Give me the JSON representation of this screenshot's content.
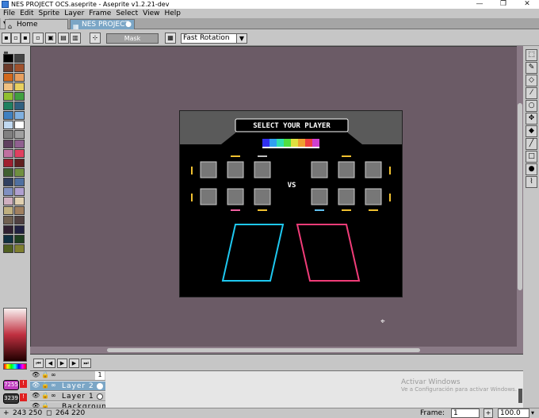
{
  "window": {
    "title": "NES PROJECT OCS.aseprite - Aseprite v1.2.21-dev",
    "minimize": "—",
    "maximize": "❐",
    "close": "✕"
  },
  "menu": [
    "File",
    "Edit",
    "Sprite",
    "Layer",
    "Frame",
    "Select",
    "View",
    "Help"
  ],
  "tabs": [
    {
      "label": "Home",
      "active": false
    },
    {
      "label": "NES PROJECT C",
      "active": true
    }
  ],
  "context_bar": {
    "mask_label": "Mask",
    "rotation_select": "Fast Rotation"
  },
  "sprite": {
    "title": "SELECT YOUR PLAYER",
    "vs_label": "VS"
  },
  "timeline": {
    "layers": [
      {
        "name": "Layer 2",
        "selected": true
      },
      {
        "name": "Layer 1",
        "selected": false
      },
      {
        "name": "Background",
        "selected": false
      }
    ],
    "frame_number": "1"
  },
  "color_panel": {
    "fg_index": "7255",
    "bg_index": "3239"
  },
  "status": {
    "cursor_pos": "243 250",
    "sprite_size": "264 220",
    "frame_label": "Frame:",
    "frame_value": "1",
    "zoom": "100.0"
  },
  "watermark": {
    "line1": "Activar Windows",
    "line2": "Ve a Configuración para activar Windows."
  },
  "colors": {
    "canvas_bg": "#6b5b66",
    "accent": "#7ba6c6",
    "cyan_box": "#1ec8f0",
    "pink_box": "#f03c78"
  }
}
